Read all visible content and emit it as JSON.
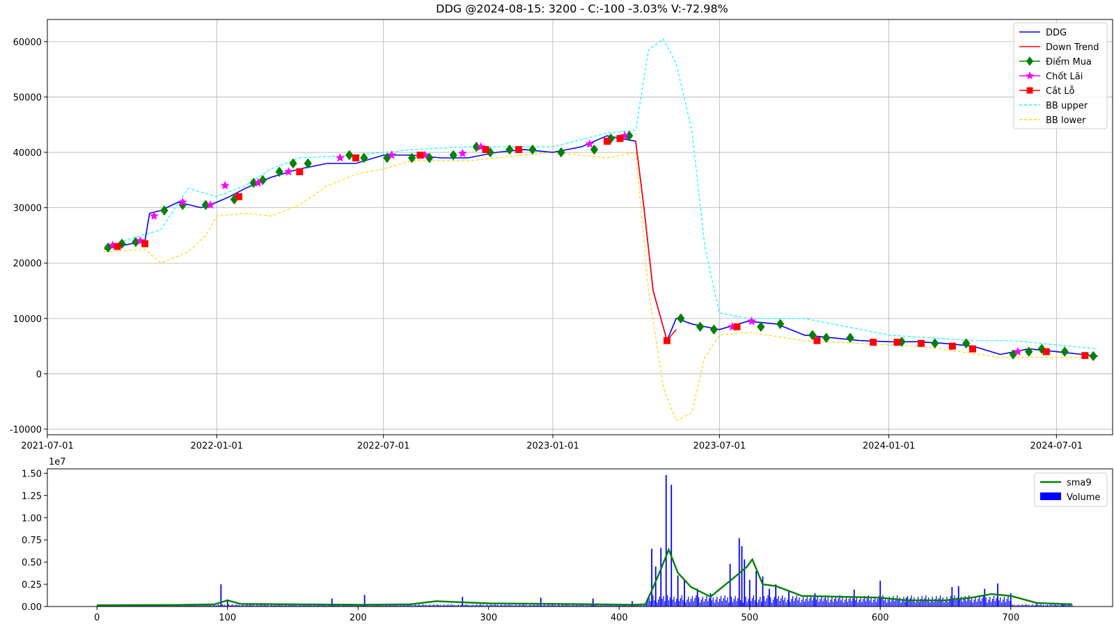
{
  "title": "DDG @2024-08-15: 3200 - C:-100 -3.03% V:-72.98%",
  "colors": {
    "price": "#0000ff",
    "down_trend": "#ff0000",
    "buy": "#008000",
    "take_profit": "#ff00ff",
    "stop_loss": "#ff0000",
    "bb_upper": "#00ffff",
    "bb_lower": "#ffd700",
    "volume": "#0000ff",
    "sma9": "#008000",
    "grid": "#b0b0b0"
  },
  "chart_data": [
    {
      "type": "line",
      "x_type": "date",
      "xlim": [
        "2021-07-01",
        "2024-08-31"
      ],
      "ylim": [
        -11000,
        64000
      ],
      "x_ticks": [
        "2021-07-01",
        "2022-01-01",
        "2022-07-01",
        "2023-01-01",
        "2023-07-01",
        "2024-01-01",
        "2024-07-01"
      ],
      "y_ticks": [
        -10000,
        0,
        10000,
        20000,
        30000,
        40000,
        50000,
        60000
      ],
      "grid": true,
      "legend_position": "top-right",
      "legend": [
        "DDG",
        "Down Trend",
        "Điểm Mua",
        "Chốt Lãi",
        "Cắt Lỗ",
        "BB upper",
        "BB lower"
      ],
      "series": [
        {
          "name": "DDG",
          "style": "solid",
          "x": [
            "2021-09-01",
            "2021-10-15",
            "2021-10-20",
            "2021-11-01",
            "2021-11-20",
            "2021-12-15",
            "2022-01-01",
            "2022-01-15",
            "2022-02-01",
            "2022-03-01",
            "2022-04-01",
            "2022-05-01",
            "2022-06-01",
            "2022-07-01",
            "2022-08-01",
            "2022-09-01",
            "2022-10-01",
            "2022-11-01",
            "2022-12-01",
            "2023-01-01",
            "2023-02-01",
            "2023-03-01",
            "2023-04-01",
            "2023-04-10",
            "2023-04-20",
            "2023-05-05",
            "2023-05-15",
            "2023-06-01",
            "2023-07-01",
            "2023-08-01",
            "2023-09-01",
            "2023-10-01",
            "2023-11-01",
            "2023-12-01",
            "2024-01-01",
            "2024-02-01",
            "2024-03-01",
            "2024-04-01",
            "2024-05-01",
            "2024-06-01",
            "2024-07-01",
            "2024-08-15"
          ],
          "y": [
            22500,
            24000,
            29000,
            29500,
            31000,
            30000,
            31000,
            32000,
            33500,
            35500,
            37000,
            38000,
            38000,
            39500,
            39500,
            39000,
            39000,
            40000,
            40500,
            40000,
            41000,
            43000,
            42000,
            30000,
            15000,
            6000,
            10000,
            9000,
            8000,
            9500,
            9000,
            7000,
            6500,
            6000,
            5800,
            5800,
            5500,
            5000,
            3500,
            4500,
            4000,
            3200
          ]
        },
        {
          "name": "Down Trend",
          "style": "solid",
          "x": [
            "2023-04-01",
            "2023-04-10",
            "2023-04-20",
            "2023-05-05",
            "2023-05-15"
          ],
          "y": [
            42000,
            30000,
            15000,
            6000,
            8000
          ]
        },
        {
          "name": "BB upper",
          "style": "dashed",
          "x": [
            "2021-09-01",
            "2021-11-01",
            "2021-12-01",
            "2022-01-01",
            "2022-02-01",
            "2022-03-01",
            "2022-04-01",
            "2022-06-01",
            "2022-08-01",
            "2022-10-01",
            "2023-01-01",
            "2023-03-01",
            "2023-04-01",
            "2023-04-15",
            "2023-05-01",
            "2023-05-15",
            "2023-06-01",
            "2023-06-15",
            "2023-07-01",
            "2023-08-01",
            "2023-10-01",
            "2023-11-01",
            "2024-01-01",
            "2024-04-01",
            "2024-05-15",
            "2024-08-15"
          ],
          "y": [
            23000,
            26000,
            33500,
            32000,
            34000,
            37000,
            39000,
            39500,
            40500,
            41000,
            41000,
            43500,
            44000,
            58500,
            60500,
            56000,
            44000,
            23000,
            11000,
            10000,
            10000,
            9000,
            7000,
            6000,
            6000,
            4500
          ]
        },
        {
          "name": "BB lower",
          "style": "dashed",
          "x": [
            "2021-09-01",
            "2021-10-15",
            "2021-11-01",
            "2021-12-01",
            "2021-12-20",
            "2022-01-01",
            "2022-02-01",
            "2022-03-01",
            "2022-04-01",
            "2022-05-01",
            "2022-06-01",
            "2022-07-01",
            "2022-08-01",
            "2022-10-01",
            "2023-01-01",
            "2023-03-01",
            "2023-04-01",
            "2023-04-15",
            "2023-05-01",
            "2023-05-15",
            "2023-06-01",
            "2023-06-15",
            "2023-07-01",
            "2023-08-01",
            "2023-10-01",
            "2023-12-01",
            "2024-02-01",
            "2024-05-01",
            "2024-08-15"
          ],
          "y": [
            22000,
            22500,
            20000,
            22000,
            25000,
            28500,
            29000,
            28500,
            30500,
            34000,
            36000,
            37000,
            38500,
            38500,
            40000,
            39000,
            40000,
            15000,
            -2500,
            -8500,
            -7000,
            3000,
            7000,
            7500,
            6000,
            5500,
            5000,
            3000,
            3000
          ]
        }
      ],
      "markers": {
        "Điểm Mua": {
          "x": [
            "2021-09-05",
            "2021-09-20",
            "2021-10-05",
            "2021-11-05",
            "2021-11-25",
            "2021-12-20",
            "2022-01-20",
            "2022-02-10",
            "2022-02-20",
            "2022-03-10",
            "2022-03-25",
            "2022-04-10",
            "2022-05-25",
            "2022-06-10",
            "2022-07-05",
            "2022-08-01",
            "2022-08-20",
            "2022-09-15",
            "2022-10-10",
            "2022-10-25",
            "2022-11-15",
            "2022-12-10",
            "2023-01-10",
            "2023-02-15",
            "2023-03-05",
            "2023-03-25",
            "2023-05-20",
            "2023-06-10",
            "2023-06-25",
            "2023-08-15",
            "2023-09-05",
            "2023-10-10",
            "2023-10-25",
            "2023-11-20",
            "2024-01-15",
            "2024-02-20",
            "2024-03-25",
            "2024-05-15",
            "2024-06-01",
            "2024-06-15",
            "2024-07-10",
            "2024-08-10"
          ],
          "y": [
            22800,
            23500,
            23800,
            29500,
            30500,
            30500,
            31500,
            34500,
            35000,
            36500,
            38000,
            38000,
            39500,
            39000,
            39000,
            39000,
            39000,
            39500,
            41000,
            40000,
            40500,
            40500,
            40000,
            40500,
            42500,
            43000,
            10000,
            8500,
            8000,
            8500,
            9000,
            7000,
            6500,
            6500,
            5800,
            5500,
            5500,
            3500,
            4000,
            4500,
            4000,
            3200
          ]
        },
        "Chốt Lãi": {
          "x": [
            "2021-09-10",
            "2021-10-10",
            "2021-10-25",
            "2021-11-25",
            "2021-12-25",
            "2022-01-10",
            "2022-02-15",
            "2022-03-20",
            "2022-05-15",
            "2022-07-10",
            "2022-08-15",
            "2022-09-25",
            "2022-10-15",
            "2023-02-10",
            "2023-03-20",
            "2023-07-15",
            "2023-08-05",
            "2024-05-20"
          ],
          "y": [
            23200,
            24000,
            28500,
            31000,
            30500,
            34000,
            34500,
            36500,
            39000,
            39500,
            39500,
            39800,
            41000,
            41500,
            43000,
            8500,
            9500,
            4000
          ]
        },
        "Cắt Lỗ": {
          "x": [
            "2021-09-15",
            "2021-10-15",
            "2022-01-25",
            "2022-04-01",
            "2022-06-01",
            "2022-08-10",
            "2022-10-20",
            "2022-11-25",
            "2023-03-01",
            "2023-03-15",
            "2023-05-05",
            "2023-07-20",
            "2023-10-15",
            "2023-12-15",
            "2024-01-10",
            "2024-02-05",
            "2024-03-10",
            "2024-04-01",
            "2024-06-20",
            "2024-08-01"
          ],
          "y": [
            23000,
            23500,
            32000,
            36500,
            39000,
            39500,
            40500,
            40500,
            42000,
            42500,
            6000,
            8500,
            6000,
            5700,
            5700,
            5500,
            5000,
            4500,
            4000,
            3300
          ]
        }
      }
    },
    {
      "type": "bar",
      "xlim": [
        -38,
        778
      ],
      "ylim": [
        0,
        15500000
      ],
      "x_ticks": [
        0,
        100,
        200,
        300,
        400,
        500,
        600,
        700
      ],
      "y_ticks": [
        0,
        0.25,
        0.5,
        0.75,
        1.0,
        1.25,
        1.5
      ],
      "y_tick_labels": [
        "0.00",
        "0.25",
        "0.50",
        "0.75",
        "1.00",
        "1.25",
        "1.50"
      ],
      "y_scale_label": "1e7",
      "legend_position": "top-right",
      "legend": [
        "sma9",
        "Volume"
      ],
      "series": [
        {
          "name": "sma9",
          "type": "line",
          "x": [
            0,
            60,
            90,
            100,
            110,
            150,
            200,
            240,
            260,
            300,
            350,
            410,
            420,
            425,
            430,
            438,
            445,
            455,
            470,
            490,
            498,
            502,
            510,
            520,
            540,
            600,
            620,
            650,
            670,
            685,
            700,
            720,
            747
          ],
          "y": [
            150000,
            180000,
            250000,
            700000,
            300000,
            250000,
            200000,
            250000,
            600000,
            350000,
            300000,
            200000,
            250000,
            1800000,
            3500000,
            6400000,
            3800000,
            2200000,
            1100000,
            3500000,
            4500000,
            5300000,
            2500000,
            2300000,
            1200000,
            1000000,
            700000,
            700000,
            1000000,
            1400000,
            1200000,
            400000,
            250000
          ]
        },
        {
          "name": "Volume",
          "type": "bar",
          "x": [
            95,
            100,
            180,
            205,
            280,
            340,
            380,
            410,
            425,
            428,
            432,
            436,
            440,
            445,
            450,
            460,
            470,
            485,
            492,
            494,
            496,
            500,
            505,
            510,
            515,
            520,
            530,
            550,
            580,
            600,
            620,
            655,
            660,
            680,
            690,
            700,
            720,
            740
          ],
          "y": [
            2500000,
            800000,
            900000,
            1300000,
            1100000,
            1000000,
            900000,
            600000,
            6500000,
            4500000,
            6600000,
            14800000,
            13700000,
            3500000,
            3000000,
            2000000,
            1500000,
            4800000,
            7700000,
            6800000,
            5300000,
            3000000,
            4000000,
            3400000,
            2000000,
            2500000,
            1800000,
            1500000,
            1900000,
            2900000,
            1000000,
            2200000,
            2300000,
            2000000,
            2600000,
            1500000,
            500000,
            200000
          ]
        }
      ]
    }
  ]
}
